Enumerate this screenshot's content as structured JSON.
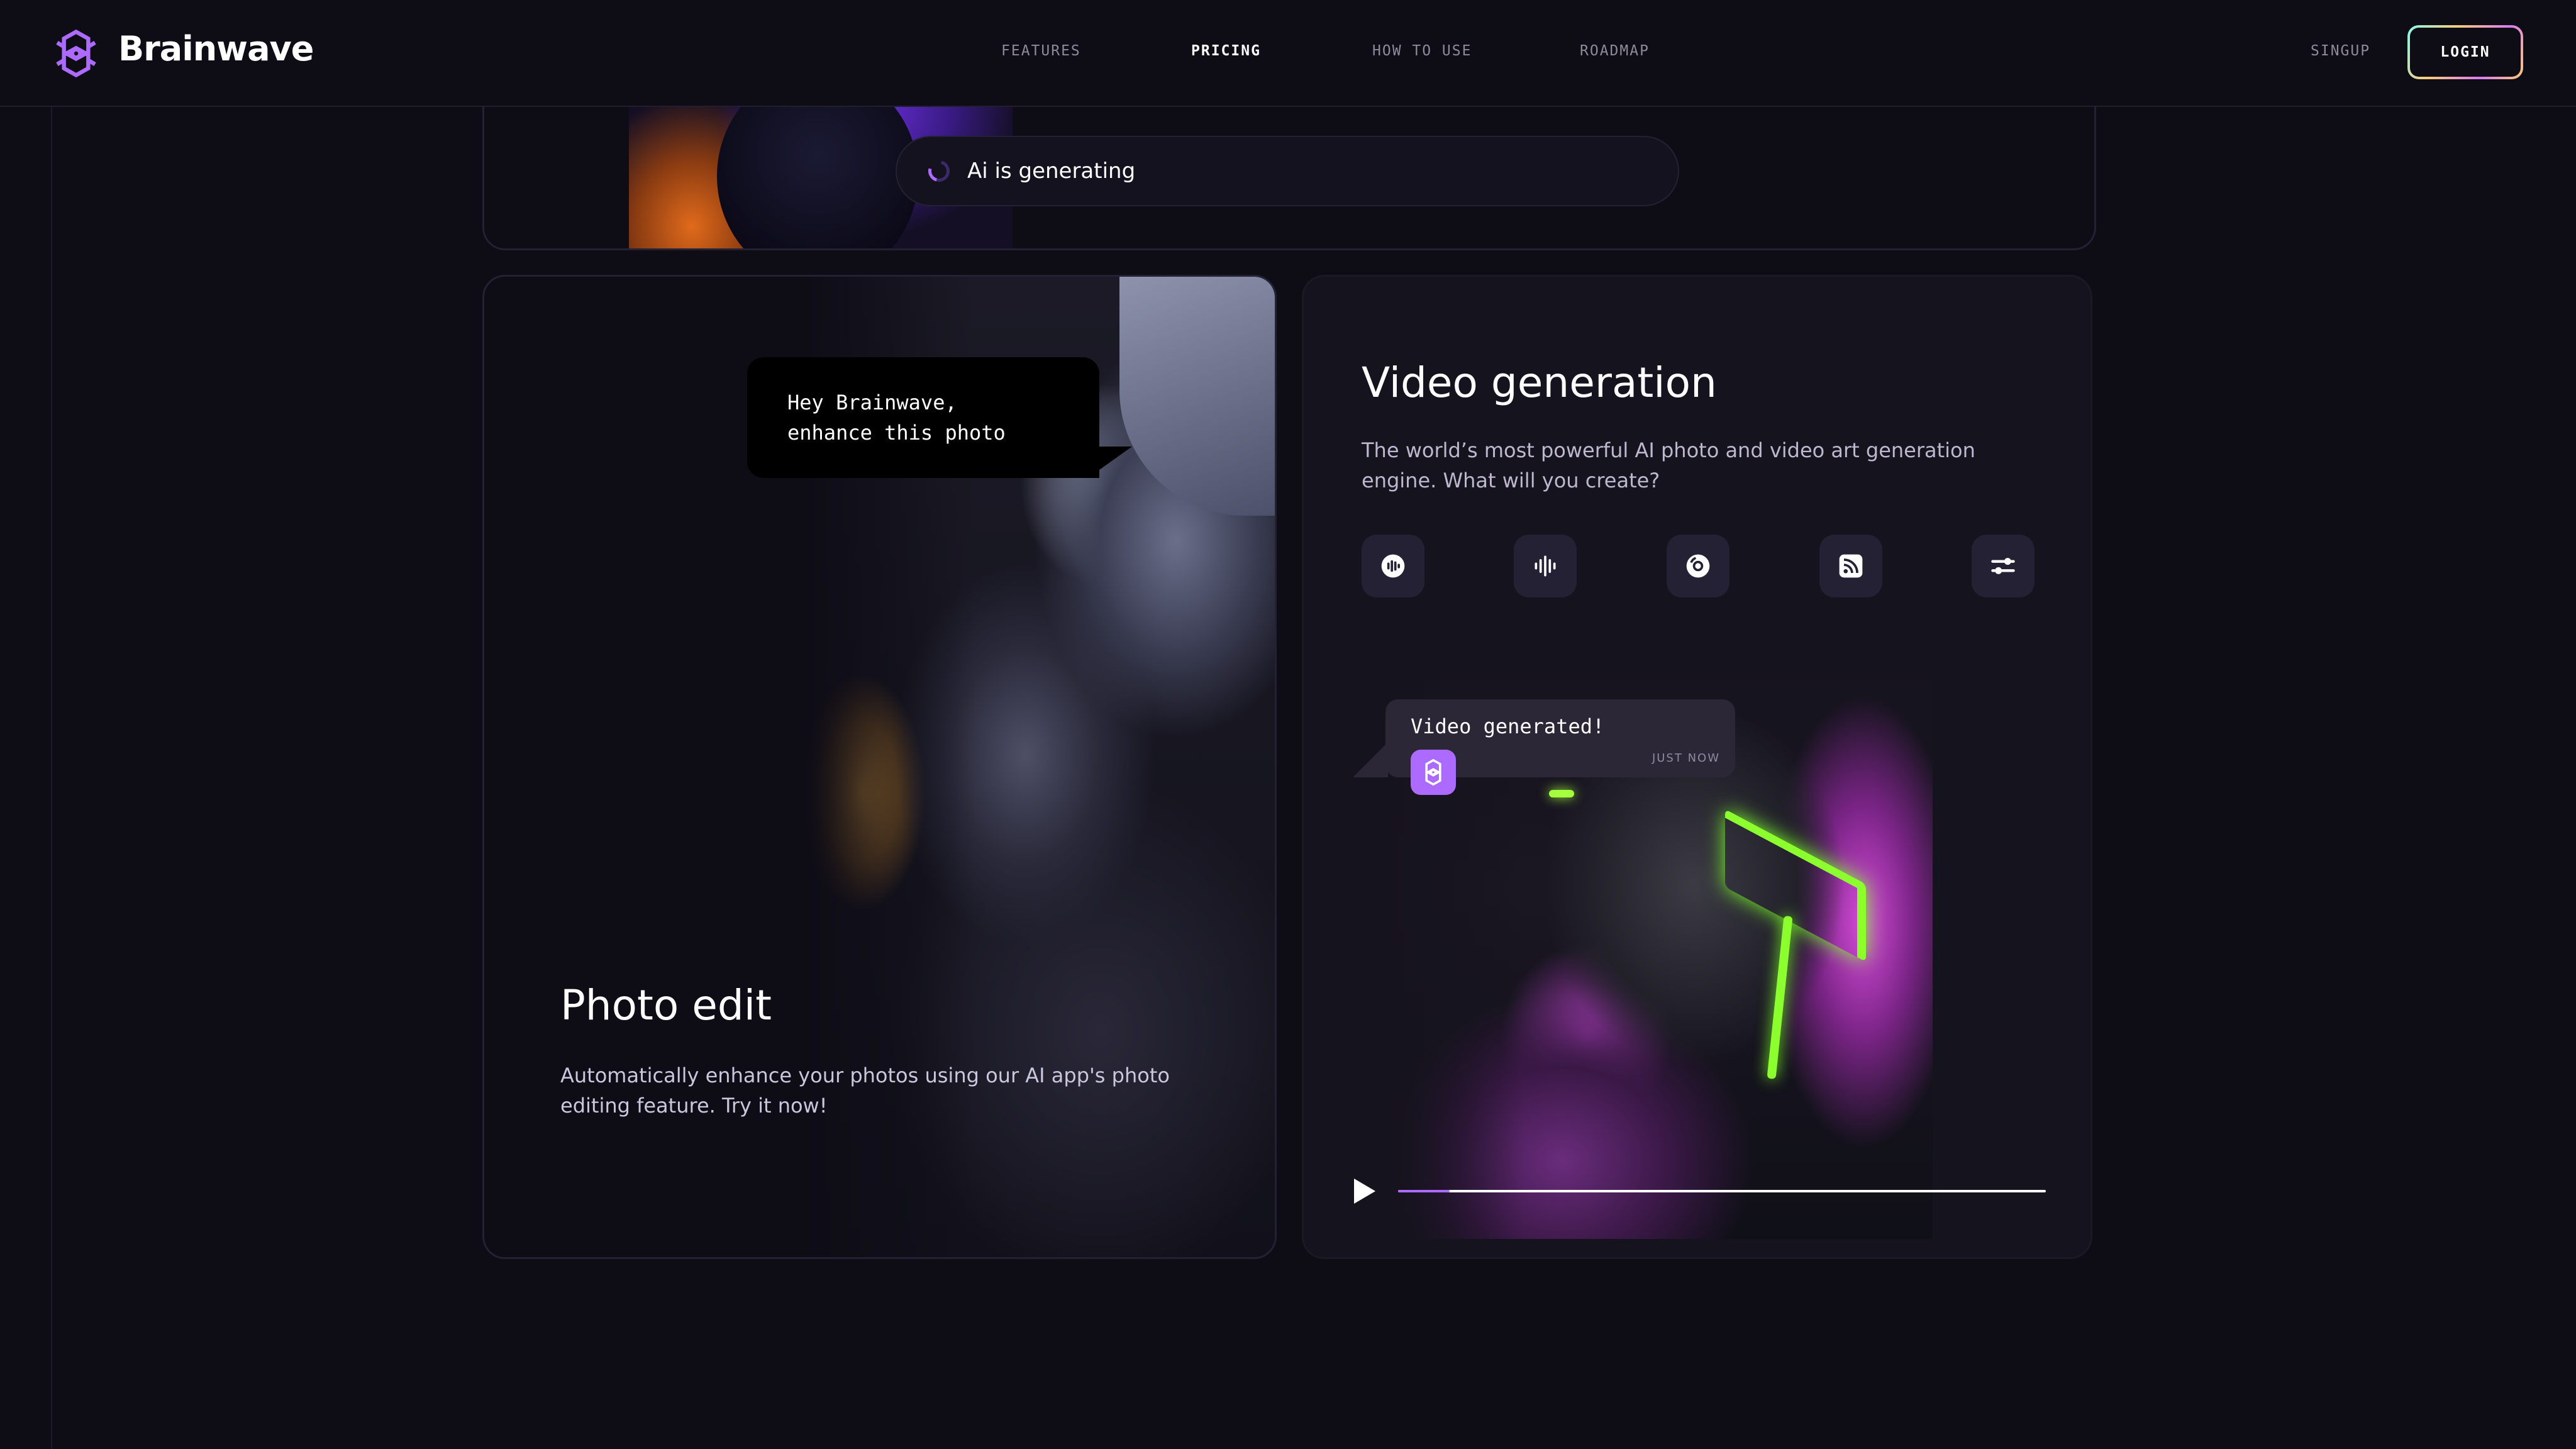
{
  "brand": {
    "name": "Brainwave"
  },
  "nav": {
    "items": [
      {
        "label": "FEATURES"
      },
      {
        "label": "PRICING"
      },
      {
        "label": "HOW TO USE"
      },
      {
        "label": "ROADMAP"
      }
    ],
    "active": "PRICING",
    "signup_label": "SINGUP",
    "login_label": "LOGIN"
  },
  "generating": {
    "text": "Ai is generating"
  },
  "photo_edit": {
    "bubble": "Hey Brainwave,\nenhance this photo",
    "title": "Photo edit",
    "description": "Automatically enhance your photos using our AI app's photo editing feature. Try it now!"
  },
  "video_generation": {
    "title": "Video generation",
    "description": "The world’s most powerful AI photo and video art generation engine. What will you create?",
    "icons": [
      "recording-icon",
      "audio-wave-icon",
      "disc-icon",
      "rss-icon",
      "sliders-icon"
    ],
    "bubble_text": "Video generated!",
    "bubble_time": "JUST NOW",
    "progress": 0.08
  },
  "colors": {
    "background": "#0e0c15",
    "accent": "#ac6aff",
    "stroke": "#252134",
    "neon": "#8cff2e"
  }
}
